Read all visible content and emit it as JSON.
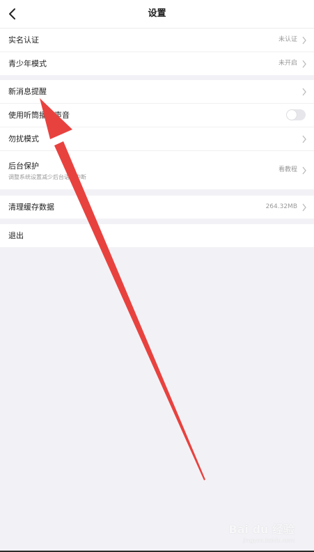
{
  "header": {
    "title": "设置",
    "back_icon": "chevron-left-icon"
  },
  "groups": [
    {
      "items": [
        {
          "label": "实名认证",
          "value": "未认证"
        },
        {
          "label": "青少年模式",
          "value": "未开启"
        }
      ]
    },
    {
      "items": [
        {
          "label": "新消息提醒"
        },
        {
          "label": "使用听筒播放声音",
          "toggle": false
        },
        {
          "label": "勿扰模式"
        },
        {
          "label": "后台保护",
          "sublabel": "调整系统设置减少后台语音中断",
          "value": "看教程"
        }
      ]
    },
    {
      "items": [
        {
          "label": "清理缓存数据",
          "value": "264.32MB"
        }
      ]
    },
    {
      "items": [
        {
          "label": "退出"
        }
      ]
    }
  ],
  "annotation": {
    "color": "#e8423f",
    "icon": "red-arrow-annotation"
  },
  "watermark": {
    "text": "Bai du 经验",
    "sub": "jingyan.baidu.com"
  }
}
